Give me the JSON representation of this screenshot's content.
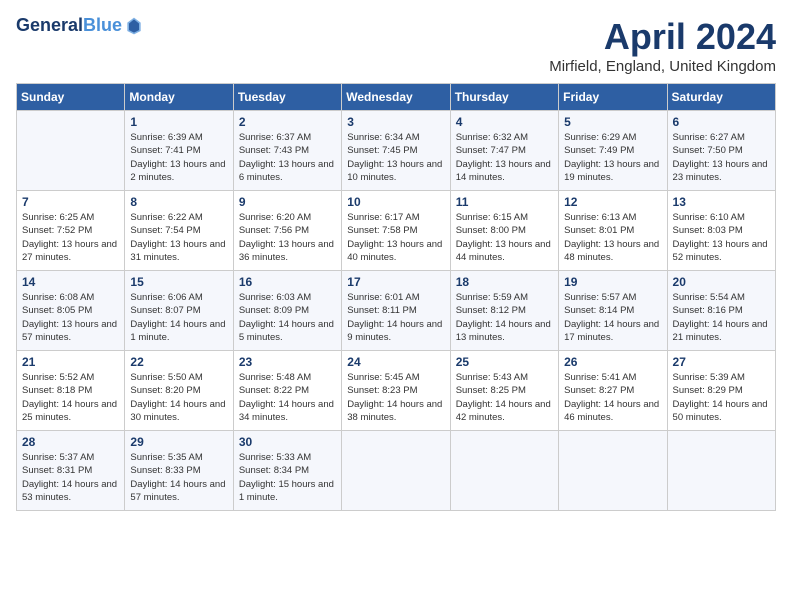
{
  "header": {
    "logo_line1": "General",
    "logo_line2": "Blue",
    "month": "April 2024",
    "location": "Mirfield, England, United Kingdom"
  },
  "weekdays": [
    "Sunday",
    "Monday",
    "Tuesday",
    "Wednesday",
    "Thursday",
    "Friday",
    "Saturday"
  ],
  "weeks": [
    [
      {
        "day": "",
        "info": ""
      },
      {
        "day": "1",
        "info": "Sunrise: 6:39 AM\nSunset: 7:41 PM\nDaylight: 13 hours\nand 2 minutes."
      },
      {
        "day": "2",
        "info": "Sunrise: 6:37 AM\nSunset: 7:43 PM\nDaylight: 13 hours\nand 6 minutes."
      },
      {
        "day": "3",
        "info": "Sunrise: 6:34 AM\nSunset: 7:45 PM\nDaylight: 13 hours\nand 10 minutes."
      },
      {
        "day": "4",
        "info": "Sunrise: 6:32 AM\nSunset: 7:47 PM\nDaylight: 13 hours\nand 14 minutes."
      },
      {
        "day": "5",
        "info": "Sunrise: 6:29 AM\nSunset: 7:49 PM\nDaylight: 13 hours\nand 19 minutes."
      },
      {
        "day": "6",
        "info": "Sunrise: 6:27 AM\nSunset: 7:50 PM\nDaylight: 13 hours\nand 23 minutes."
      }
    ],
    [
      {
        "day": "7",
        "info": "Sunrise: 6:25 AM\nSunset: 7:52 PM\nDaylight: 13 hours\nand 27 minutes."
      },
      {
        "day": "8",
        "info": "Sunrise: 6:22 AM\nSunset: 7:54 PM\nDaylight: 13 hours\nand 31 minutes."
      },
      {
        "day": "9",
        "info": "Sunrise: 6:20 AM\nSunset: 7:56 PM\nDaylight: 13 hours\nand 36 minutes."
      },
      {
        "day": "10",
        "info": "Sunrise: 6:17 AM\nSunset: 7:58 PM\nDaylight: 13 hours\nand 40 minutes."
      },
      {
        "day": "11",
        "info": "Sunrise: 6:15 AM\nSunset: 8:00 PM\nDaylight: 13 hours\nand 44 minutes."
      },
      {
        "day": "12",
        "info": "Sunrise: 6:13 AM\nSunset: 8:01 PM\nDaylight: 13 hours\nand 48 minutes."
      },
      {
        "day": "13",
        "info": "Sunrise: 6:10 AM\nSunset: 8:03 PM\nDaylight: 13 hours\nand 52 minutes."
      }
    ],
    [
      {
        "day": "14",
        "info": "Sunrise: 6:08 AM\nSunset: 8:05 PM\nDaylight: 13 hours\nand 57 minutes."
      },
      {
        "day": "15",
        "info": "Sunrise: 6:06 AM\nSunset: 8:07 PM\nDaylight: 14 hours\nand 1 minute."
      },
      {
        "day": "16",
        "info": "Sunrise: 6:03 AM\nSunset: 8:09 PM\nDaylight: 14 hours\nand 5 minutes."
      },
      {
        "day": "17",
        "info": "Sunrise: 6:01 AM\nSunset: 8:11 PM\nDaylight: 14 hours\nand 9 minutes."
      },
      {
        "day": "18",
        "info": "Sunrise: 5:59 AM\nSunset: 8:12 PM\nDaylight: 14 hours\nand 13 minutes."
      },
      {
        "day": "19",
        "info": "Sunrise: 5:57 AM\nSunset: 8:14 PM\nDaylight: 14 hours\nand 17 minutes."
      },
      {
        "day": "20",
        "info": "Sunrise: 5:54 AM\nSunset: 8:16 PM\nDaylight: 14 hours\nand 21 minutes."
      }
    ],
    [
      {
        "day": "21",
        "info": "Sunrise: 5:52 AM\nSunset: 8:18 PM\nDaylight: 14 hours\nand 25 minutes."
      },
      {
        "day": "22",
        "info": "Sunrise: 5:50 AM\nSunset: 8:20 PM\nDaylight: 14 hours\nand 30 minutes."
      },
      {
        "day": "23",
        "info": "Sunrise: 5:48 AM\nSunset: 8:22 PM\nDaylight: 14 hours\nand 34 minutes."
      },
      {
        "day": "24",
        "info": "Sunrise: 5:45 AM\nSunset: 8:23 PM\nDaylight: 14 hours\nand 38 minutes."
      },
      {
        "day": "25",
        "info": "Sunrise: 5:43 AM\nSunset: 8:25 PM\nDaylight: 14 hours\nand 42 minutes."
      },
      {
        "day": "26",
        "info": "Sunrise: 5:41 AM\nSunset: 8:27 PM\nDaylight: 14 hours\nand 46 minutes."
      },
      {
        "day": "27",
        "info": "Sunrise: 5:39 AM\nSunset: 8:29 PM\nDaylight: 14 hours\nand 50 minutes."
      }
    ],
    [
      {
        "day": "28",
        "info": "Sunrise: 5:37 AM\nSunset: 8:31 PM\nDaylight: 14 hours\nand 53 minutes."
      },
      {
        "day": "29",
        "info": "Sunrise: 5:35 AM\nSunset: 8:33 PM\nDaylight: 14 hours\nand 57 minutes."
      },
      {
        "day": "30",
        "info": "Sunrise: 5:33 AM\nSunset: 8:34 PM\nDaylight: 15 hours\nand 1 minute."
      },
      {
        "day": "",
        "info": ""
      },
      {
        "day": "",
        "info": ""
      },
      {
        "day": "",
        "info": ""
      },
      {
        "day": "",
        "info": ""
      }
    ]
  ]
}
